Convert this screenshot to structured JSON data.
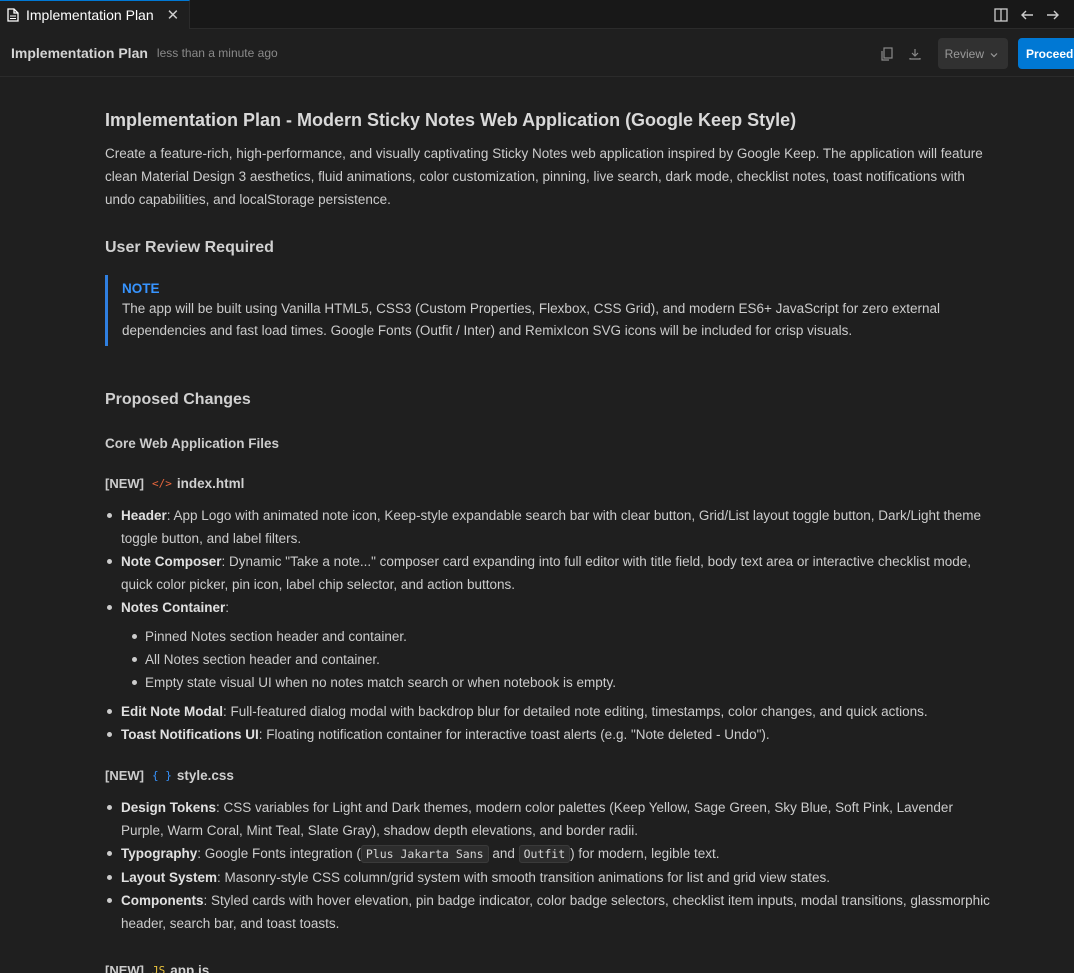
{
  "tab": {
    "label": "Implementation Plan",
    "close": "✕"
  },
  "header": {
    "title": "Implementation Plan",
    "time": "less than a minute ago",
    "review_label": "Review",
    "proceed_label": "Proceed"
  },
  "doc": {
    "title": "Implementation Plan - Modern Sticky Notes Web Application (Google Keep Style)",
    "intro": "Create a feature-rich, high-performance, and visually captivating Sticky Notes web application inspired by Google Keep. The application will feature clean Material Design 3 aesthetics, fluid animations, color customization, pinning, live search, dark mode, checklist notes, toast notifications with undo capabilities, and localStorage persistence.",
    "review_heading": "User Review Required",
    "note_label": "NOTE",
    "note_text": "The app will be built using Vanilla HTML5, CSS3 (Custom Properties, Flexbox, CSS Grid), and modern ES6+ JavaScript for zero external dependencies and fast load times. Google Fonts (Outfit / Inter) and RemixIcon SVG icons will be included for crisp visuals.",
    "changes_heading": "Proposed Changes",
    "core_heading": "Core Web Application Files",
    "new_tag": "[NEW]",
    "file1": {
      "icon": "</>",
      "name": "index.html",
      "items": [
        {
          "label": "Header",
          "text": ": App Logo with animated note icon, Keep-style expandable search bar with clear button, Grid/List layout toggle button, Dark/Light theme toggle button, and label filters."
        },
        {
          "label": "Note Composer",
          "text": ": Dynamic \"Take a note...\" composer card expanding into full editor with title field, body text area or interactive checklist mode, quick color picker, pin icon, label chip selector, and action buttons."
        },
        {
          "label": "Notes Container",
          "text": ":"
        }
      ],
      "sub_items": [
        "Pinned Notes section header and container.",
        "All Notes section header and container.",
        "Empty state visual UI when no notes match search or when notebook is empty."
      ],
      "items2": [
        {
          "label": "Edit Note Modal",
          "text": ": Full-featured dialog modal with backdrop blur for detailed note editing, timestamps, color changes, and quick actions."
        },
        {
          "label": "Toast Notifications UI",
          "text": ": Floating notification container for interactive toast alerts (e.g. \"Note deleted - Undo\")."
        }
      ]
    },
    "file2": {
      "icon": "{ }",
      "name": "style.css",
      "items": [
        {
          "label": "Design Tokens",
          "text": ": CSS variables for Light and Dark themes, modern color palettes (Keep Yellow, Sage Green, Sky Blue, Soft Pink, Lavender Purple, Warm Coral, Mint Teal, Slate Gray), shadow depth elevations, and border radii."
        },
        {
          "label": "Typography",
          "pre": ": Google Fonts integration (",
          "code1": "Plus Jakarta Sans",
          "mid": " and ",
          "code2": "Outfit",
          "post": ") for modern, legible text."
        },
        {
          "label": "Layout System",
          "text": ": Masonry-style CSS column/grid system with smooth transition animations for list and grid view states."
        },
        {
          "label": "Components",
          "text": ": Styled cards with hover elevation, pin badge indicator, color badge selectors, checklist item inputs, modal transitions, glassmorphic header, search bar, and toast toasts."
        }
      ]
    },
    "file3": {
      "icon": "JS",
      "name": "app.js"
    }
  }
}
